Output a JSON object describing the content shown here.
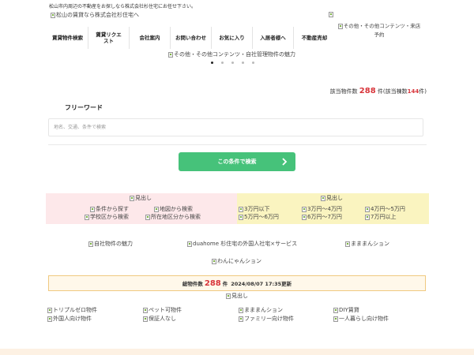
{
  "header": {
    "tagline": "松山市内周辺の不動産をお探しなら株式会社杉住宅にお任せ下さい。",
    "logo_alt": "松山の賃貸なら株式会社杉住宅へ",
    "banner_alt_line1": "その他・その他コンテンツ・来店",
    "banner_alt_line2": "予約"
  },
  "nav": {
    "items": [
      {
        "label": "賃貸物件検索"
      },
      {
        "label": "賃貸リクエスト"
      },
      {
        "label": "会社案内"
      },
      {
        "label": "お問い合わせ"
      },
      {
        "label": "お気に入り"
      },
      {
        "label": "入居者様へ"
      },
      {
        "label": "不動産売却"
      }
    ]
  },
  "slider": {
    "alt": "その他・その他コンテンツ・自社管理物件の魅力",
    "dot_count": 5,
    "active_dot": 0
  },
  "results": {
    "prefix": "該当物件数",
    "count": "288",
    "mid": "件(該当棟数",
    "building_count": "144",
    "suffix": "件)"
  },
  "search": {
    "free_word_label": "フリーワード",
    "placeholder": "地名、交通、条件で検索",
    "submit_label": "この条件で検索"
  },
  "pink_panel": {
    "heading_alt": "見出し",
    "links": [
      "条件から探す",
      "地図から検索",
      "学校区から検索",
      "所在地区分から検索"
    ]
  },
  "yellow_panel": {
    "heading_alt": "見出し",
    "links": [
      "3万円以下",
      "3万円～4万円",
      "4万円～5万円",
      "5万円～6万円",
      "6万円～7万円",
      "7万円以上"
    ]
  },
  "promo": {
    "items": [
      "自社物件の魅力",
      "duahome 杉住宅の外国人社宅×サービス",
      "まままんション",
      "わんにゃんション"
    ]
  },
  "notice": {
    "label": "総物件数",
    "count": "288",
    "unit": "件",
    "updated": "2024/08/07 17:35更新"
  },
  "features": {
    "heading_alt": "見出し",
    "items": [
      "トリプルゼロ物件",
      "ペット可物件",
      "まままんション",
      "DIY賃貸",
      "外国人向け物件",
      "保証人なし",
      "ファミリー向け物件",
      "一人暮らし向け物件"
    ]
  },
  "colors": {
    "accent_green": "#46c27a",
    "count_red": "#d8343a",
    "pink_panel": "#fde8ea",
    "yellow_panel": "#faf4c0",
    "notice_border": "#f0c980"
  }
}
